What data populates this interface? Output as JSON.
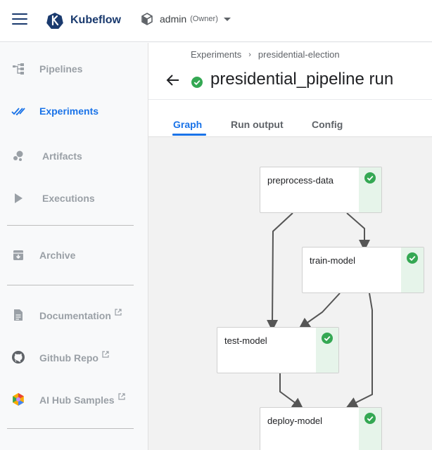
{
  "header": {
    "brand": "Kubeflow",
    "namespace_user": "admin",
    "namespace_role": "(Owner)"
  },
  "sidebar": {
    "items": [
      {
        "label": "Pipelines",
        "icon": "pipelines-icon"
      },
      {
        "label": "Experiments",
        "icon": "experiments-icon",
        "active": true
      },
      {
        "label": "Artifacts",
        "icon": "artifacts-icon"
      },
      {
        "label": "Executions",
        "icon": "executions-icon"
      },
      {
        "label": "Archive",
        "icon": "archive-icon"
      },
      {
        "label": "Documentation",
        "icon": "document-icon",
        "external": true
      },
      {
        "label": "Github Repo",
        "icon": "github-icon",
        "external": true
      },
      {
        "label": "AI Hub Samples",
        "icon": "ai-hub-icon",
        "external": true
      }
    ]
  },
  "breadcrumb": {
    "items": [
      "Experiments",
      "presidential-election"
    ],
    "separator": "›"
  },
  "run": {
    "title": "presidential_pipeline run",
    "status": "succeeded"
  },
  "tabs": [
    {
      "label": "Graph",
      "active": true
    },
    {
      "label": "Run output"
    },
    {
      "label": "Config"
    }
  ],
  "graph": {
    "nodes": [
      {
        "name": "preprocess-data",
        "status": "succeeded"
      },
      {
        "name": "train-model",
        "status": "succeeded"
      },
      {
        "name": "test-model",
        "status": "succeeded"
      },
      {
        "name": "deploy-model",
        "status": "succeeded"
      }
    ]
  },
  "colors": {
    "accent": "#1a73e8",
    "success": "#34a853",
    "success_bg": "#e6f4ea",
    "brand": "#1a3a6e"
  }
}
